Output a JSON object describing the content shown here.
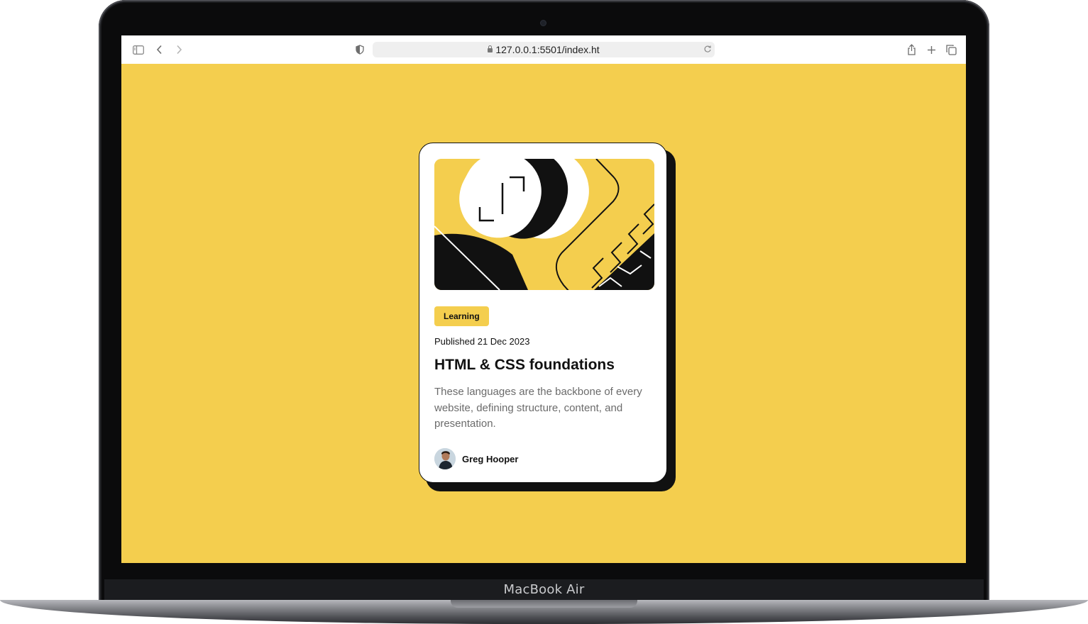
{
  "device": {
    "label": "MacBook Air"
  },
  "browser": {
    "url": "127.0.0.1:5501/index.ht",
    "icons": [
      "sidebar-icon",
      "back-icon",
      "forward-icon",
      "shield-icon",
      "lock-icon",
      "reload-icon",
      "share-icon",
      "new-tab-icon",
      "tabs-overview-icon"
    ]
  },
  "page": {
    "background_color": "#f4ce4e",
    "card": {
      "tag": "Learning",
      "published": "Published 21 Dec 2023",
      "title": "HTML & CSS foundations",
      "description": "These languages are the backbone of every website, defining structure, content, and presentation.",
      "author": "Greg Hooper"
    }
  }
}
